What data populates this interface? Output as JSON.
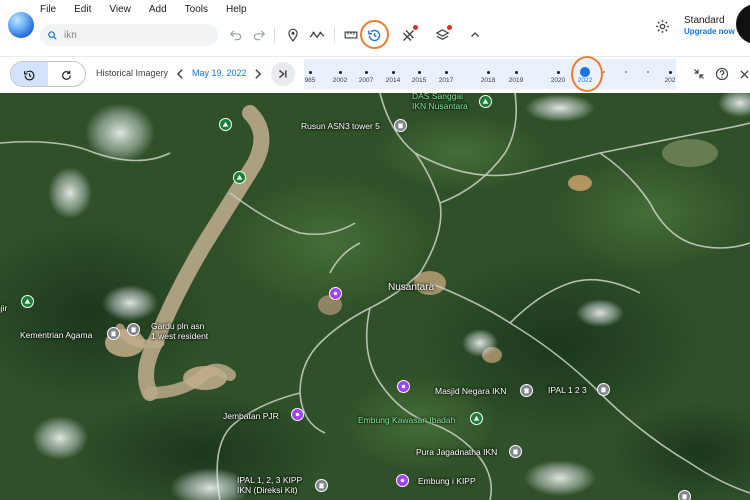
{
  "menu": [
    "File",
    "Edit",
    "View",
    "Add",
    "Tools",
    "Help"
  ],
  "search": {
    "value": "ikn"
  },
  "toolbar_icons": [
    "undo-icon",
    "redo-icon",
    "placemark-icon",
    "path-icon",
    "ruler-icon",
    "historical-imagery-icon",
    "projects-icon",
    "map-layers-icon",
    "collapse-chevron-icon"
  ],
  "account": {
    "plan": "Standard",
    "upgrade": "Upgrade now"
  },
  "historical": {
    "label": "Historical Imagery",
    "date": "May 19, 2022",
    "ticks": [
      "985",
      "2002",
      "2007",
      "2014",
      "2015",
      "2017",
      "2018",
      "2019",
      "2020",
      "2022",
      "202"
    ],
    "selected_year": "2022"
  },
  "colors": {
    "accent": "#1a73e8",
    "highlight_ring": "#ef7d2d",
    "green_pin": "#188038",
    "purple_pin": "#a142f4"
  },
  "map": {
    "places": [
      {
        "name": "DAS Sanggai\nIKN Nusantara",
        "type": "green"
      },
      {
        "name": "Rusun ASN3 tower 5",
        "type": "gray"
      },
      {
        "name": "Nusantara",
        "type": "purple"
      },
      {
        "name": "Kementrian Agama",
        "type": "gray"
      },
      {
        "name": "Gardu pln asn\n1 west resident",
        "type": "gray"
      },
      {
        "name": "Masjid Negara IKN",
        "type": "gray"
      },
      {
        "name": "IPAL 1 2 3",
        "type": "gray"
      },
      {
        "name": "Embung Kawasan Ibadah",
        "type": "green"
      },
      {
        "name": "Jembatan PJR",
        "type": "purple"
      },
      {
        "name": "Pura Jagadnatha IKN",
        "type": "gray"
      },
      {
        "name": "IPAL 1, 2, 3 KIPP\nIKN (Direksi Kit)",
        "type": "gray"
      },
      {
        "name": "Embung i KIPP",
        "type": "purple"
      },
      {
        "name": "njir",
        "type": "green"
      }
    ]
  }
}
